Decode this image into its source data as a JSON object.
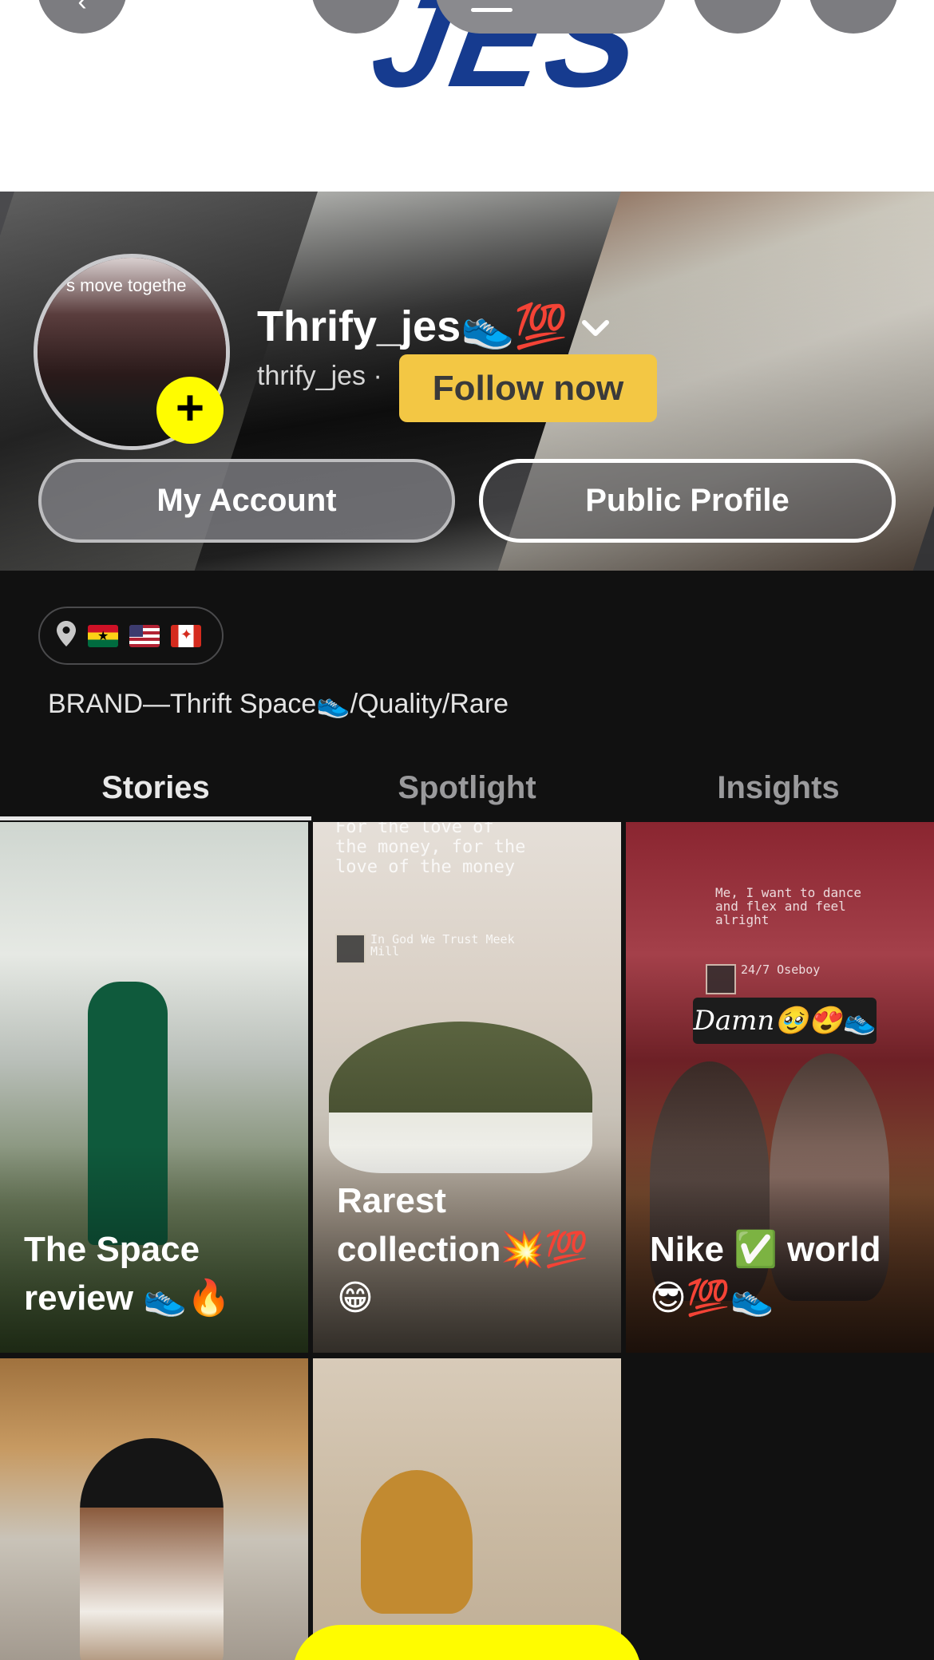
{
  "header": {
    "logo_text": "JES"
  },
  "profile": {
    "display_name": "Thrify_jes👟💯",
    "username": "thrify_jes ·",
    "follow_label": "Follow now",
    "my_account_label": "My Account",
    "public_profile_label": "Public Profile",
    "avatar_snippet": "s move togethe",
    "flags": [
      "Ghana",
      "United States",
      "Canada"
    ],
    "bio": "BRAND—Thrift Space👟/Quality/Rare"
  },
  "tabs": [
    {
      "label": "Stories",
      "active": true
    },
    {
      "label": "Spotlight",
      "active": false
    },
    {
      "label": "Insights",
      "active": false
    }
  ],
  "stories": [
    {
      "title": "The Space review 👟🔥",
      "caption": ""
    },
    {
      "title": "Rarest collection💥💯 😁",
      "caption": "For the love of the money, for the love of the money",
      "song": "In God We Trust Meek Mill"
    },
    {
      "title": "Nike ✅ world 😎💯👟",
      "caption": "Me, I want to dance and flex and feel alright",
      "song": "24/7 Oseboy",
      "sticker": "Damn🥹😍👟"
    }
  ],
  "colors": {
    "background": "#111111",
    "snap_yellow": "#fffc00",
    "follow_button": "#f3c744",
    "logo_blue": "#163b8f"
  }
}
